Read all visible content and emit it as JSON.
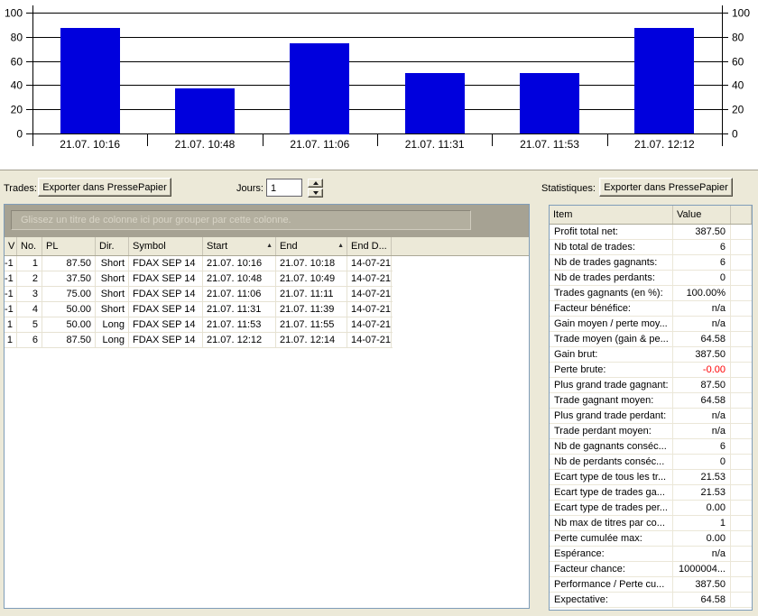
{
  "chart_data": {
    "type": "bar",
    "title": "",
    "xlabel": "",
    "ylabel": "",
    "categories": [
      "21.07. 10:16",
      "21.07. 10:48",
      "21.07. 11:06",
      "21.07. 11:31",
      "21.07. 11:53",
      "21.07. 12:12"
    ],
    "values": [
      87.5,
      37.5,
      75,
      50,
      50,
      87.5
    ],
    "ylim": [
      0,
      100
    ],
    "yticks": [
      0,
      20,
      40,
      60,
      80,
      100
    ],
    "grid": true,
    "bar_color": "#0000dd",
    "axis_color": "#000000",
    "y_axis_sides": "both"
  },
  "toolbar": {
    "trades_label": "Trades:",
    "export_button": "Exporter dans PressePapier",
    "jours_label": "Jours:",
    "jours_value": "1"
  },
  "statistics_header": {
    "label": "Statistiques:",
    "export_button": "Exporter dans PressePapier"
  },
  "trades_table": {
    "group_hint": "Glissez un titre de colonne ici pour grouper par cette colonne.",
    "columns": [
      "V",
      "No.",
      "PL",
      "Dir.",
      "Symbol",
      "Start",
      "End",
      "End D..."
    ],
    "sorted_columns": [
      "Start",
      "End"
    ],
    "sort_direction": "asc",
    "rows": [
      [
        "-1",
        "1",
        "87.50",
        "Short",
        "FDAX SEP 14",
        "21.07. 10:16",
        "21.07. 10:18",
        "14-07-21"
      ],
      [
        "-1",
        "2",
        "37.50",
        "Short",
        "FDAX SEP 14",
        "21.07. 10:48",
        "21.07. 10:49",
        "14-07-21"
      ],
      [
        "-1",
        "3",
        "75.00",
        "Short",
        "FDAX SEP 14",
        "21.07. 11:06",
        "21.07. 11:11",
        "14-07-21"
      ],
      [
        "-1",
        "4",
        "50.00",
        "Short",
        "FDAX SEP 14",
        "21.07. 11:31",
        "21.07. 11:39",
        "14-07-21"
      ],
      [
        "1",
        "5",
        "50.00",
        "Long",
        "FDAX SEP 14",
        "21.07. 11:53",
        "21.07. 11:55",
        "14-07-21"
      ],
      [
        "1",
        "6",
        "87.50",
        "Long",
        "FDAX SEP 14",
        "21.07. 12:12",
        "21.07. 12:14",
        "14-07-21"
      ]
    ]
  },
  "stats_table": {
    "columns": [
      "Item",
      "Value"
    ],
    "negative_color": "#ff0000",
    "rows": [
      {
        "item": "Profit total net:",
        "value": "387.50"
      },
      {
        "item": "Nb total de trades:",
        "value": "6"
      },
      {
        "item": "Nb de trades gagnants:",
        "value": "6"
      },
      {
        "item": "Nb de trades perdants:",
        "value": "0"
      },
      {
        "item": "Trades gagnants (en %):",
        "value": "100.00%"
      },
      {
        "item": "Facteur bénéfice:",
        "value": "n/a"
      },
      {
        "item": "Gain moyen / perte moy...",
        "value": "n/a"
      },
      {
        "item": "Trade moyen (gain & pe...",
        "value": "64.58"
      },
      {
        "item": "Gain brut:",
        "value": "387.50"
      },
      {
        "item": "Perte brute:",
        "value": "-0.00",
        "negative": true
      },
      {
        "item": "Plus grand trade gagnant:",
        "value": "87.50"
      },
      {
        "item": "Trade gagnant moyen:",
        "value": "64.58"
      },
      {
        "item": "Plus grand trade perdant:",
        "value": "n/a"
      },
      {
        "item": "Trade perdant moyen:",
        "value": "n/a"
      },
      {
        "item": "Nb de gagnants conséc...",
        "value": "6"
      },
      {
        "item": "Nb de perdants conséc...",
        "value": "0"
      },
      {
        "item": "Ecart type de tous les tr...",
        "value": "21.53"
      },
      {
        "item": "Ecart type de trades ga...",
        "value": "21.53"
      },
      {
        "item": "Ecart type de trades per...",
        "value": "0.00"
      },
      {
        "item": "Nb max de titres par co...",
        "value": "1"
      },
      {
        "item": "Perte cumulée max:",
        "value": "0.00"
      },
      {
        "item": "Espérance:",
        "value": "n/a"
      },
      {
        "item": "Facteur chance:",
        "value": "1000004..."
      },
      {
        "item": "Performance / Perte cu...",
        "value": "387.50"
      },
      {
        "item": "Expectative:",
        "value": "64.58"
      }
    ]
  }
}
